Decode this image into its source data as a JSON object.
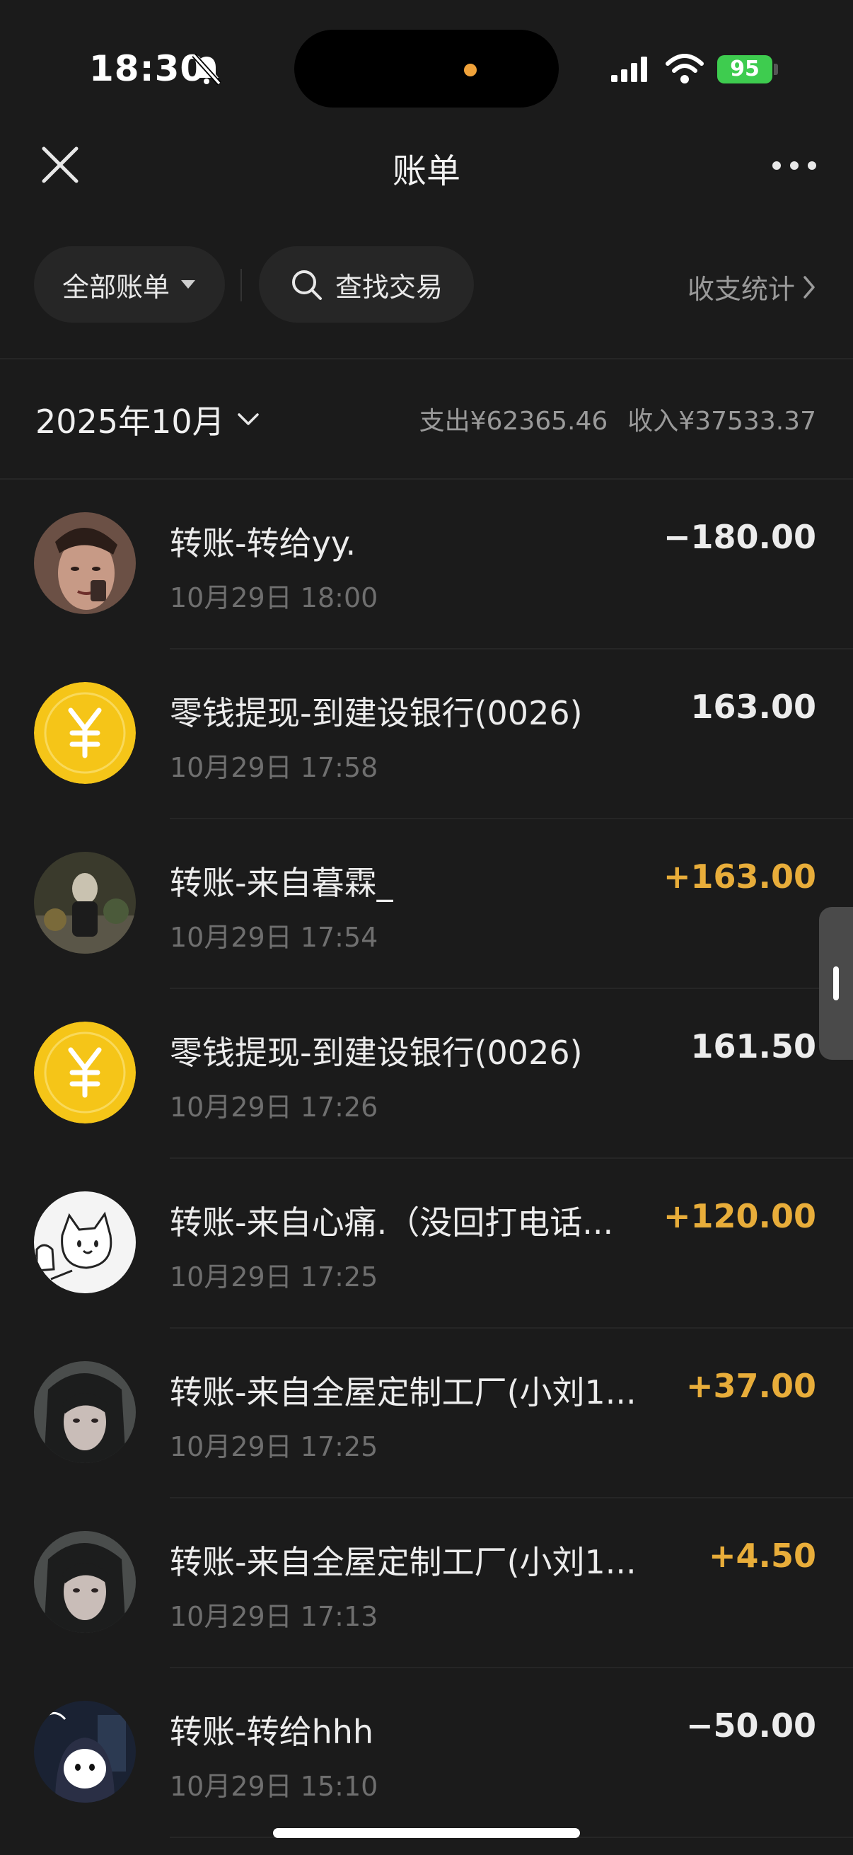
{
  "status_bar": {
    "time": "18:30",
    "battery": "95"
  },
  "nav": {
    "title": "账单"
  },
  "filters": {
    "all_bills": "全部账单",
    "search": "查找交易",
    "stats": "收支统计"
  },
  "month": {
    "label": "2025年10月",
    "expense": "支出¥62365.46",
    "income": "收入¥37533.37"
  },
  "transactions": [
    {
      "title": "转账-转给yy.",
      "date": "10月29日 18:00",
      "amount": "−180.00",
      "kind": "expense",
      "avatar": "photo-avatar"
    },
    {
      "title": "零钱提现-到建设银行(0026)",
      "date": "10月29日 17:58",
      "amount": "163.00",
      "kind": "neutral",
      "avatar": "yuan-coin-icon"
    },
    {
      "title": "转账-来自暮霖_",
      "date": "10月29日 17:54",
      "amount": "+163.00",
      "kind": "income",
      "avatar": "photo-avatar"
    },
    {
      "title": "零钱提现-到建设银行(0026)",
      "date": "10月29日 17:26",
      "amount": "161.50",
      "kind": "neutral",
      "avatar": "yuan-coin-icon"
    },
    {
      "title": "转账-来自心痛.（没回打电话...",
      "date": "10月29日 17:25",
      "amount": "+120.00",
      "kind": "income",
      "avatar": "cartoon-cat-avatar"
    },
    {
      "title": "转账-来自全屋定制工厂(小刘1...",
      "date": "10月29日 17:25",
      "amount": "+37.00",
      "kind": "income",
      "avatar": "photo-avatar"
    },
    {
      "title": "转账-来自全屋定制工厂(小刘1...",
      "date": "10月29日 17:13",
      "amount": "+4.50",
      "kind": "income",
      "avatar": "photo-avatar"
    },
    {
      "title": "转账-转给hhh",
      "date": "10月29日 15:10",
      "amount": "−50.00",
      "kind": "expense",
      "avatar": "cartoon-avatar"
    }
  ],
  "colors": {
    "background": "#1b1b1b",
    "income": "#e8ad3a",
    "coin": "#f5c518",
    "battery": "#3ecc4f"
  }
}
